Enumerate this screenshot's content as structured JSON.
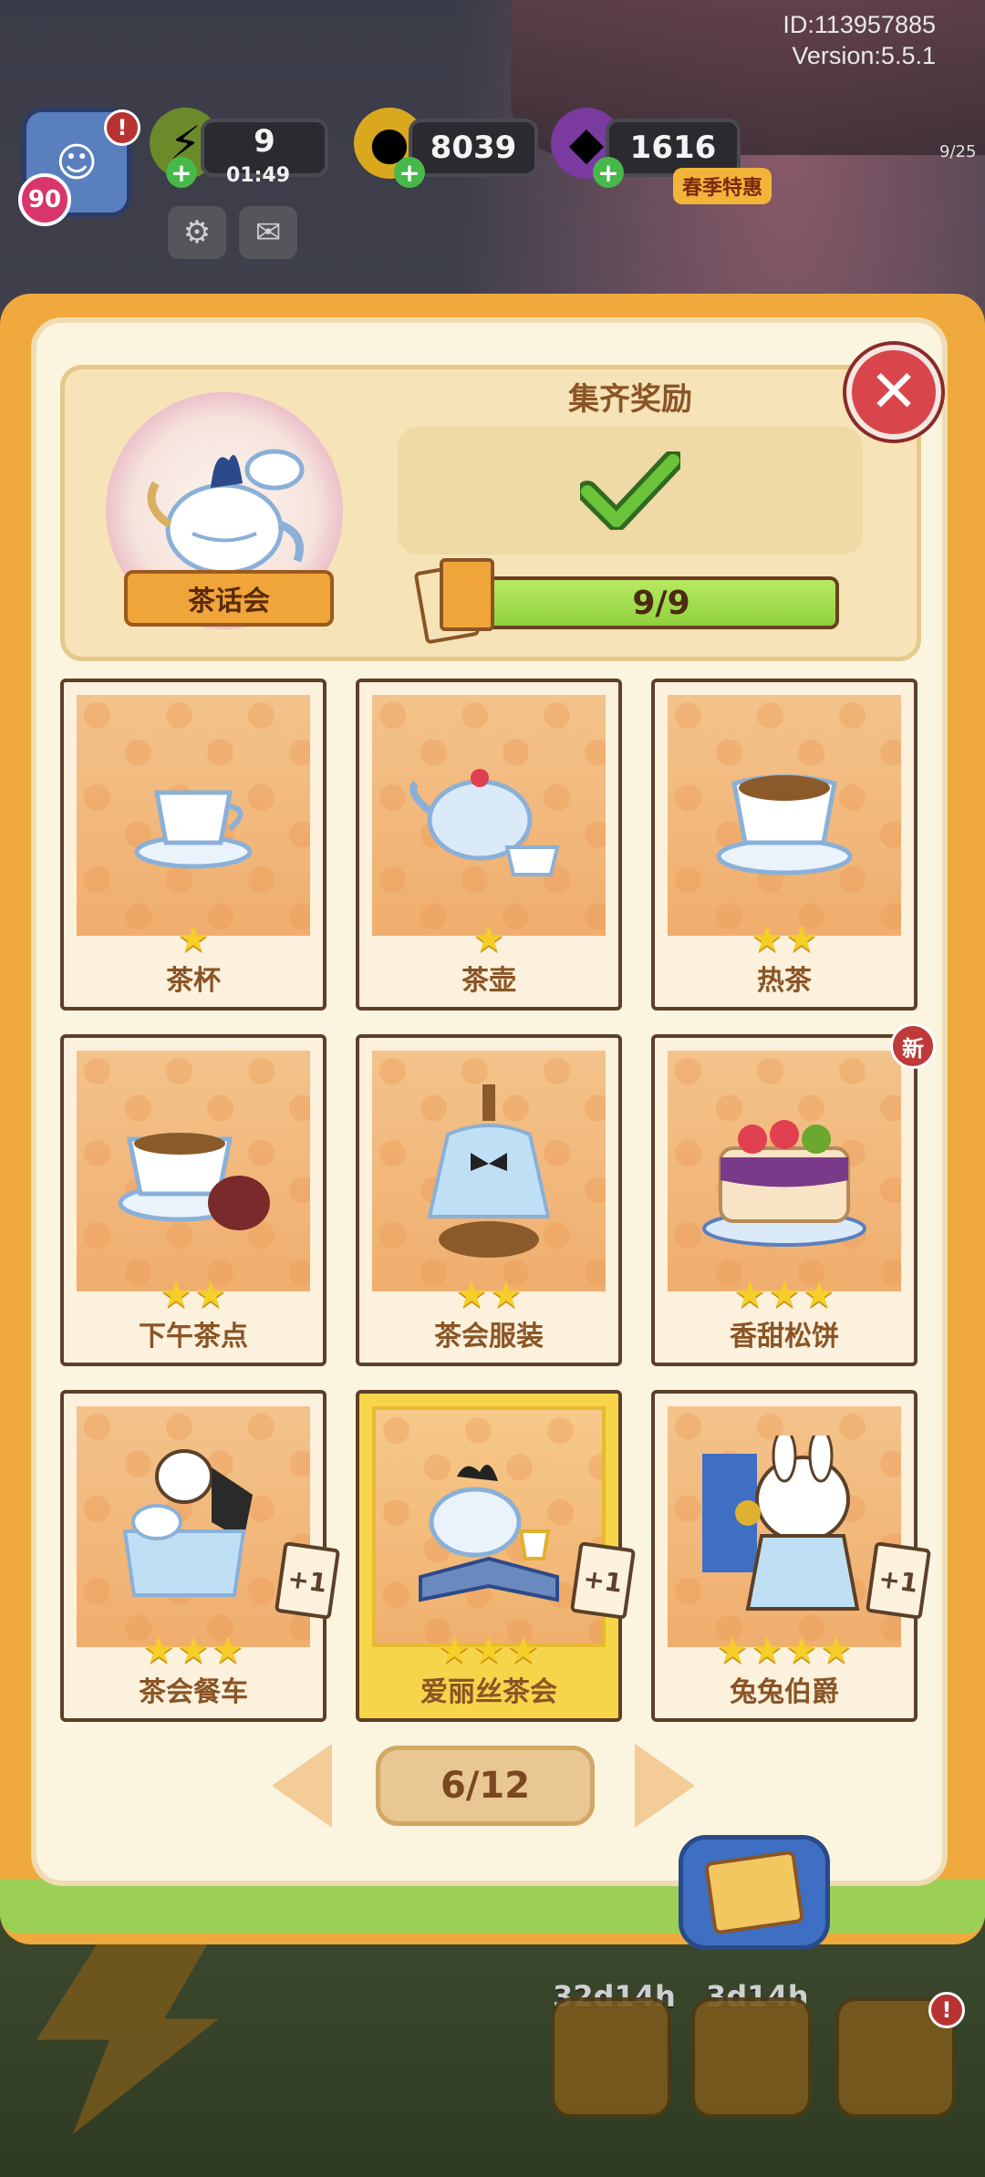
{
  "hud": {
    "id_text": "ID:113957885",
    "version_text": "Version:5.5.1",
    "level": "90",
    "energy": "9",
    "energy_timer": "01:49",
    "coins": "8039",
    "gems": "1616",
    "sale_label": "春季特惠",
    "side_counter": "9/25"
  },
  "album": {
    "name": "茶话会",
    "reward_title": "集齐奖励",
    "progress_text": "9/9",
    "progress_fraction": 1.0
  },
  "cards": [
    {
      "name": "茶杯",
      "stars": 1,
      "highlight": false,
      "new": false,
      "plus_one": false
    },
    {
      "name": "茶壶",
      "stars": 1,
      "highlight": false,
      "new": false,
      "plus_one": false
    },
    {
      "name": "热茶",
      "stars": 2,
      "highlight": false,
      "new": false,
      "plus_one": false
    },
    {
      "name": "下午茶点",
      "stars": 2,
      "highlight": false,
      "new": false,
      "plus_one": false
    },
    {
      "name": "茶会服装",
      "stars": 2,
      "highlight": false,
      "new": false,
      "plus_one": false
    },
    {
      "name": "香甜松饼",
      "stars": 3,
      "highlight": false,
      "new": true,
      "plus_one": false
    },
    {
      "name": "茶会餐车",
      "stars": 3,
      "highlight": false,
      "new": false,
      "plus_one": true
    },
    {
      "name": "爱丽丝茶会",
      "stars": 3,
      "highlight": true,
      "new": false,
      "plus_one": true
    },
    {
      "name": "兔兔伯爵",
      "stars": 4,
      "highlight": false,
      "new": false,
      "plus_one": true
    }
  ],
  "badges": {
    "new_label": "新",
    "plus_one_label": "+1"
  },
  "pagination": {
    "page_text": "6/12"
  },
  "bottom": {
    "timer_left": "32d14h",
    "timer_mid": "3d14h"
  }
}
